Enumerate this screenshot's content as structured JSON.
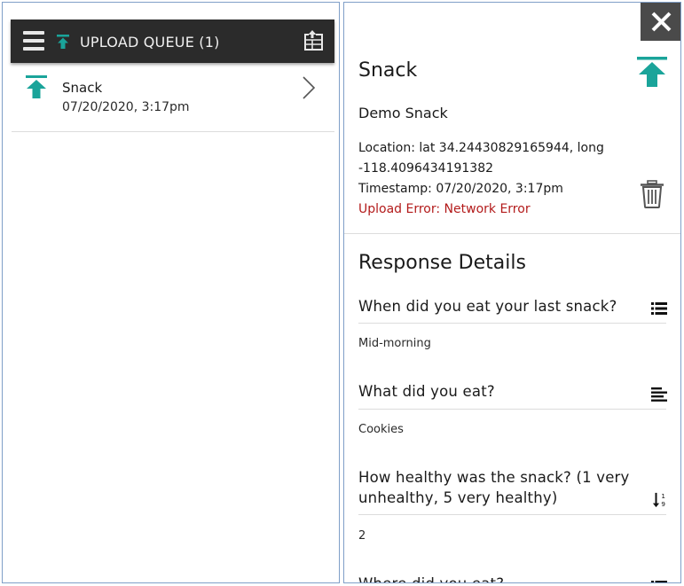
{
  "queue": {
    "header": {
      "title": "UPLOAD QUEUE (1)",
      "menu_icon": "hamburger-menu-icon",
      "upload_icon": "upload-arrow-icon",
      "export_icon": "export-table-icon"
    },
    "items": [
      {
        "title": "Snack",
        "timestamp": "07/20/2020, 3:17pm"
      }
    ]
  },
  "detail": {
    "title": "Snack",
    "subtitle": "Demo Snack",
    "location_line1": "Location: lat 34.24430829165944, long",
    "location_line2": "-118.4096434191382",
    "timestamp": "Timestamp: 07/20/2020, 3:17pm",
    "error": "Upload Error: Network Error",
    "section_title": "Response Details",
    "responses": [
      {
        "question": "When did you eat your last snack?",
        "answer": "Mid-morning",
        "icon": "list-icon"
      },
      {
        "question": "What did you eat?",
        "answer": "Cookies",
        "icon": "text-lines-icon"
      },
      {
        "question": "How healthy was the snack? (1 very unhealthy, 5 very healthy)",
        "answer": "2",
        "icon": "numeric-sort-icon"
      },
      {
        "question": "Where did you eat?",
        "answer": "",
        "icon": "list-icon"
      }
    ]
  },
  "colors": {
    "accent_teal": "#1aa49a",
    "header_bg": "#2b2b2b",
    "error_red": "#b31b1b",
    "close_bg": "#4a4a4a"
  }
}
